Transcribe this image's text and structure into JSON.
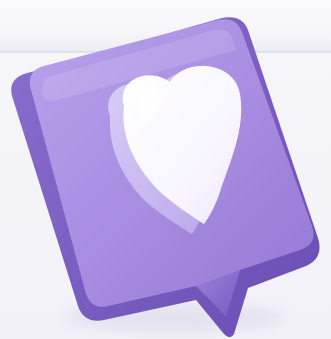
{
  "illustration": {
    "icon": "heart-speech-bubble-icon",
    "colors": {
      "background": "#f3f3f8",
      "bubble_face": "#a88ee0",
      "bubble_side": "#7d5fc4",
      "heart": "#ffffff"
    }
  }
}
